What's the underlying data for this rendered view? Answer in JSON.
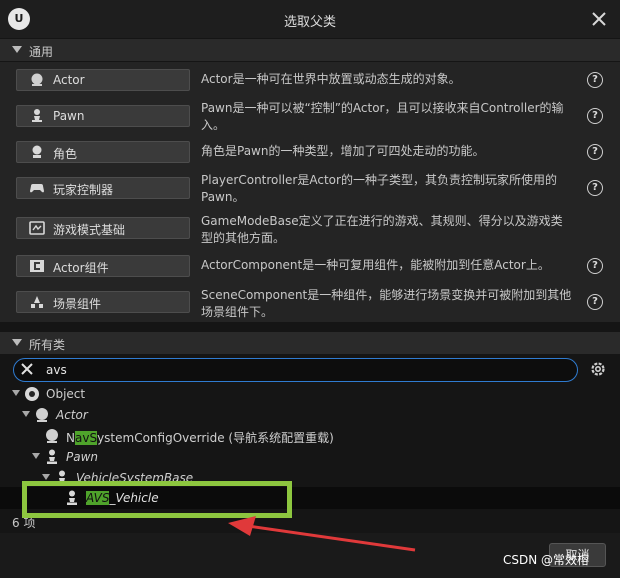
{
  "dialog": {
    "title": "选取父类",
    "close_label": "✕",
    "logo_text": "U"
  },
  "common_section": {
    "label": "通用",
    "items": [
      {
        "label": "Actor",
        "icon": "actor-sphere-icon",
        "desc": "Actor是一种可在世界中放置或动态生成的对象。"
      },
      {
        "label": "Pawn",
        "icon": "pawn-icon",
        "desc": "Pawn是一种可以被“控制”的Actor，且可以接收来自Controller的输入。"
      },
      {
        "label": "角色",
        "icon": "character-icon",
        "desc": "角色是Pawn的一种类型，增加了可四处走动的功能。"
      },
      {
        "label": "玩家控制器",
        "icon": "gamepad-icon",
        "desc": "PlayerController是Actor的一种子类型，其负责控制玩家所使用的Pawn。"
      },
      {
        "label": "游戏模式基础",
        "icon": "gamemode-icon",
        "desc": "GameModeBase定义了正在进行的游戏、其规则、得分以及游戏类型的其他方面。"
      },
      {
        "label": "Actor组件",
        "icon": "component-icon",
        "desc": "ActorComponent是一种可复用组件，能被附加到任意Actor上。"
      },
      {
        "label": "场景组件",
        "icon": "scene-component-icon",
        "desc": "SceneComponent是一种组件，能够进行场景变换并可被附加到其他场景组件下。"
      }
    ],
    "help_glyph": "?"
  },
  "all_classes": {
    "label": "所有类",
    "search_value": "avs",
    "tree": {
      "object": "Object",
      "actor": "Actor",
      "nav_pre": "N",
      "nav_hl": "avS",
      "nav_post": "ystemConfigOverride (导航系统配置重载)",
      "pawn": "Pawn",
      "vehicle_base": "VehicleSystemBase",
      "avs_hl": "AVS",
      "avs_post": "_Vehicle"
    },
    "count_label": "6 项"
  },
  "footer": {
    "cancel_label": "取消",
    "watermark": "CSDN @常效榕"
  },
  "colors": {
    "accent_blue": "#2f7bd0",
    "match_green": "#4fa32b",
    "annotation_green": "#8dc63f",
    "annotation_red": "#e0393a"
  }
}
